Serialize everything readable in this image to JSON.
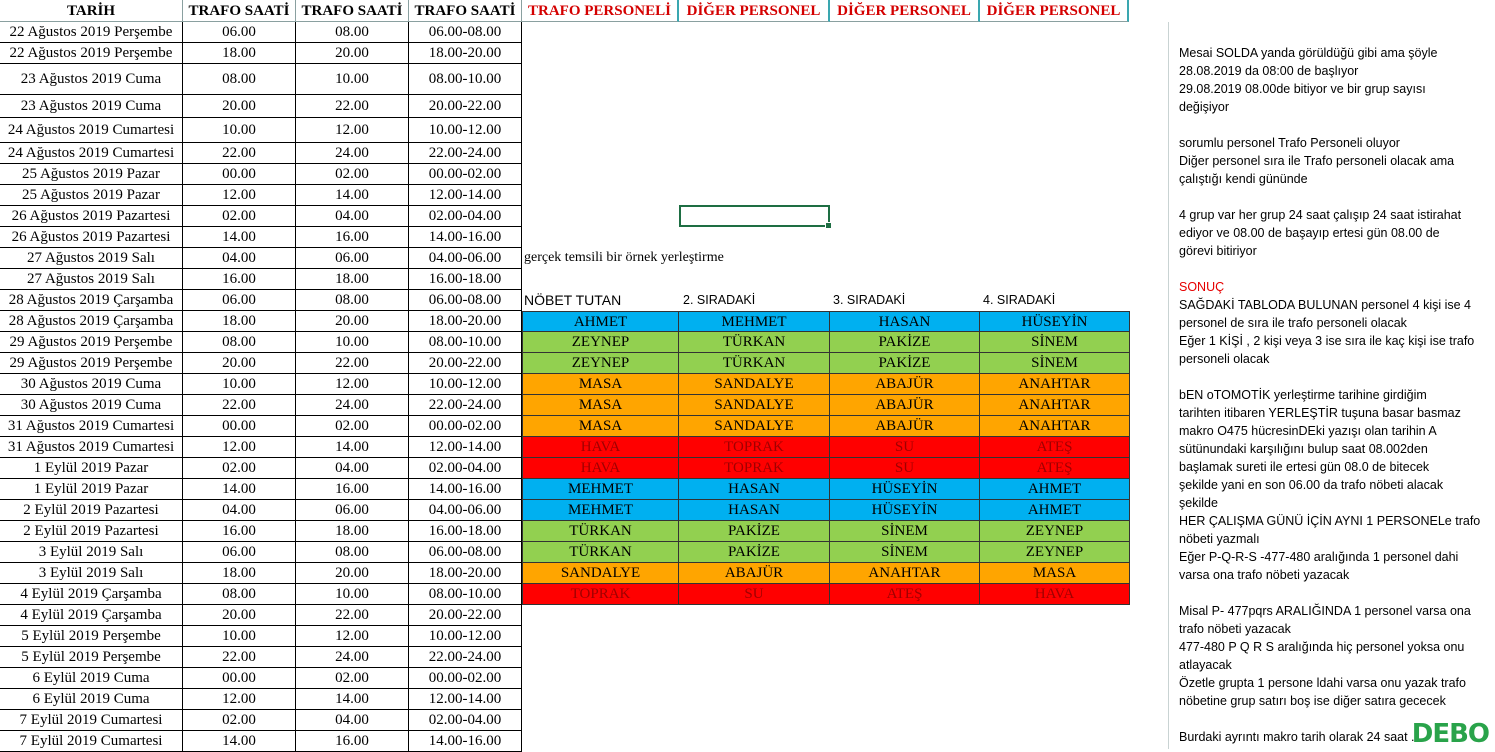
{
  "headers": {
    "col1": "TARİH",
    "col2": "TRAFO SAATİ",
    "col3": "TRAFO SAATİ",
    "col4": "TRAFO SAATİ",
    "col5": "TRAFO PERSONELİ",
    "col6": "DİĞER PERSONEL",
    "col7": "DİĞER PERSONEL",
    "col8": "DİĞER PERSONEL"
  },
  "rows": [
    [
      "22 Ağustos 2019 Perşembe",
      "06.00",
      "08.00",
      "06.00-08.00"
    ],
    [
      "22 Ağustos 2019 Perşembe",
      "18.00",
      "20.00",
      "18.00-20.00"
    ],
    [
      "23 Ağustos 2019 Cuma",
      "08.00",
      "10.00",
      "08.00-10.00"
    ],
    [
      "23 Ağustos 2019 Cuma",
      "20.00",
      "22.00",
      "20.00-22.00"
    ],
    [
      "24 Ağustos 2019 Cumartesi",
      "10.00",
      "12.00",
      "10.00-12.00"
    ],
    [
      "24 Ağustos 2019 Cumartesi",
      "22.00",
      "24.00",
      "22.00-24.00"
    ],
    [
      "25 Ağustos 2019 Pazar",
      "00.00",
      "02.00",
      "00.00-02.00"
    ],
    [
      "25 Ağustos 2019 Pazar",
      "12.00",
      "14.00",
      "12.00-14.00"
    ],
    [
      "26 Ağustos 2019 Pazartesi",
      "02.00",
      "04.00",
      "02.00-04.00"
    ],
    [
      "26 Ağustos 2019 Pazartesi",
      "14.00",
      "16.00",
      "14.00-16.00"
    ],
    [
      "27 Ağustos 2019 Salı",
      "04.00",
      "06.00",
      "04.00-06.00"
    ],
    [
      "27 Ağustos 2019 Salı",
      "16.00",
      "18.00",
      "16.00-18.00"
    ],
    [
      "28 Ağustos 2019 Çarşamba",
      "06.00",
      "08.00",
      "06.00-08.00"
    ],
    [
      "28 Ağustos 2019 Çarşamba",
      "18.00",
      "20.00",
      "18.00-20.00"
    ],
    [
      "29 Ağustos 2019 Perşembe",
      "08.00",
      "10.00",
      "08.00-10.00"
    ],
    [
      "29 Ağustos 2019 Perşembe",
      "20.00",
      "22.00",
      "20.00-22.00"
    ],
    [
      "30 Ağustos 2019 Cuma",
      "10.00",
      "12.00",
      "10.00-12.00"
    ],
    [
      "30 Ağustos 2019 Cuma",
      "22.00",
      "24.00",
      "22.00-24.00"
    ],
    [
      "31 Ağustos 2019 Cumartesi",
      "00.00",
      "02.00",
      "00.00-02.00"
    ],
    [
      "31 Ağustos 2019 Cumartesi",
      "12.00",
      "14.00",
      "12.00-14.00"
    ],
    [
      "1 Eylül 2019 Pazar",
      "02.00",
      "04.00",
      "02.00-04.00"
    ],
    [
      "1 Eylül 2019 Pazar",
      "14.00",
      "16.00",
      "14.00-16.00"
    ],
    [
      "2 Eylül 2019 Pazartesi",
      "04.00",
      "06.00",
      "04.00-06.00"
    ],
    [
      "2 Eylül 2019 Pazartesi",
      "16.00",
      "18.00",
      "16.00-18.00"
    ],
    [
      "3 Eylül 2019 Salı",
      "06.00",
      "08.00",
      "06.00-08.00"
    ],
    [
      "3 Eylül 2019 Salı",
      "18.00",
      "20.00",
      "18.00-20.00"
    ],
    [
      "4 Eylül 2019 Çarşamba",
      "08.00",
      "10.00",
      "08.00-10.00"
    ],
    [
      "4 Eylül 2019 Çarşamba",
      "20.00",
      "22.00",
      "20.00-22.00"
    ],
    [
      "5 Eylül 2019 Perşembe",
      "10.00",
      "12.00",
      "10.00-12.00"
    ],
    [
      "5 Eylül 2019 Perşembe",
      "22.00",
      "24.00",
      "22.00-24.00"
    ],
    [
      "6 Eylül 2019 Cuma",
      "00.00",
      "02.00",
      "00.00-02.00"
    ],
    [
      "6 Eylül 2019 Cuma",
      "12.00",
      "14.00",
      "12.00-14.00"
    ],
    [
      "7 Eylül 2019 Cumartesi",
      "02.00",
      "04.00",
      "02.00-04.00"
    ],
    [
      "7 Eylül 2019 Cumartesi",
      "14.00",
      "16.00",
      "14.00-16.00"
    ]
  ],
  "example_label": "gerçek temsili bir örnek yerleştirme",
  "group_headers": [
    "NÖBET TUTAN",
    "2. SIRADAKİ",
    "3. SIRADAKİ",
    "4. SIRADAKİ"
  ],
  "group_rows": [
    {
      "color": "blue",
      "cells": [
        "AHMET",
        "MEHMET",
        "HASAN",
        "HÜSEYİN"
      ]
    },
    {
      "color": "green",
      "cells": [
        "ZEYNEP",
        "TÜRKAN",
        "PAKİZE",
        "SİNEM"
      ]
    },
    {
      "color": "green",
      "cells": [
        "ZEYNEP",
        "TÜRKAN",
        "PAKİZE",
        "SİNEM"
      ]
    },
    {
      "color": "orange",
      "cells": [
        "MASA",
        "SANDALYE",
        "ABAJÜR",
        "ANAHTAR"
      ]
    },
    {
      "color": "orange",
      "cells": [
        "MASA",
        "SANDALYE",
        "ABAJÜR",
        "ANAHTAR"
      ]
    },
    {
      "color": "orange",
      "cells": [
        "MASA",
        "SANDALYE",
        "ABAJÜR",
        "ANAHTAR"
      ]
    },
    {
      "color": "red",
      "cells": [
        "HAVA",
        "TOPRAK",
        "SU",
        "ATEŞ"
      ]
    },
    {
      "color": "red",
      "cells": [
        "HAVA",
        "TOPRAK",
        "SU",
        "ATEŞ"
      ]
    },
    {
      "color": "blue",
      "cells": [
        "MEHMET",
        "HASAN",
        "HÜSEYİN",
        "AHMET"
      ]
    },
    {
      "color": "blue",
      "cells": [
        "MEHMET",
        "HASAN",
        "HÜSEYİN",
        "AHMET"
      ]
    },
    {
      "color": "green",
      "cells": [
        "TÜRKAN",
        "PAKİZE",
        "SİNEM",
        "ZEYNEP"
      ]
    },
    {
      "color": "green",
      "cells": [
        "TÜRKAN",
        "PAKİZE",
        "SİNEM",
        "ZEYNEP"
      ]
    },
    {
      "color": "orange",
      "cells": [
        "SANDALYE",
        "ABAJÜR",
        "ANAHTAR",
        "MASA"
      ]
    },
    {
      "color": "red",
      "cells": [
        "TOPRAK",
        "SU",
        "ATEŞ",
        "HAVA"
      ]
    }
  ],
  "colors": {
    "blue": "#00b0f0",
    "green": "#92d050",
    "orange": "#ffa500",
    "red": "#ff0000"
  },
  "note": {
    "p1": [
      "Mesai  SOLDA yanda görüldüğü gibi ama şöyle",
      "28.08.2019 da 08:00 de başlıyor",
      "29.08.2019 08.00de bitiyor ve bir grup sayısı",
      "değişiyor"
    ],
    "p2": [
      "sorumlu personel Trafo Personeli oluyor",
      "Diğer personel sıra ile Trafo personeli olacak ama",
      "çalıştığı kendi gününde"
    ],
    "p3": [
      "4 grup var her grup 24 saat çalışıp 24 saat istirahat",
      "ediyor ve 08.00 de başayıp ertesi gün 08.00 de",
      "görevi bitiriyor"
    ],
    "sonuc": "SONUÇ",
    "p4": [
      "SAĞDAKİ TABLODA BULUNAN personel 4 kişi ise 4",
      "personel de sıra ile trafo personeli olacak",
      "Eğer 1 KİŞİ , 2 kişi veya 3 ise sıra ile kaç kişi ise trafo",
      "personeli olacak"
    ],
    "p5": [
      "bEN oTOMOTİK yerleştirme tarihine girdiğim",
      "tarihten itibaren YERLEŞTİR tuşuna basar basmaz",
      "makro O475 hücresinDEki yazışı olan tarihin A",
      "sütünundaki karşılığını bulup saat 08.002den",
      "başlamak sureti ile ertesi gün 08.0 de bitecek",
      "şekilde yani en son 06.00 da trafo nöbeti alacak",
      "şekilde",
      "HER ÇALIŞMA GÜNÜ İÇİN AYNI 1 PERSONELe trafo",
      "nöbeti yazmalı",
      " Eğer P-Q-R-S -477-480 aralığında 1 personel dahi",
      "varsa ona trafo nöbeti yazacak"
    ],
    "p6": [
      "Misal P- 477pqrs ARALIĞINDA 1 personel varsa ona",
      "trafo nöbeti yazacak",
      " 477-480 P Q R S aralığında hiç personel yoksa onu",
      "atlayacak",
      "Özetle grupta 1 persone ldahi varsa onu yazak trafo",
      "nöbetine grup satırı boş ise diğer satıra gececek"
    ],
    "p7": [
      " Burdaki ayrıntı makro tarih olarak 24 saat ..."
    ]
  },
  "watermark": "DEBO"
}
